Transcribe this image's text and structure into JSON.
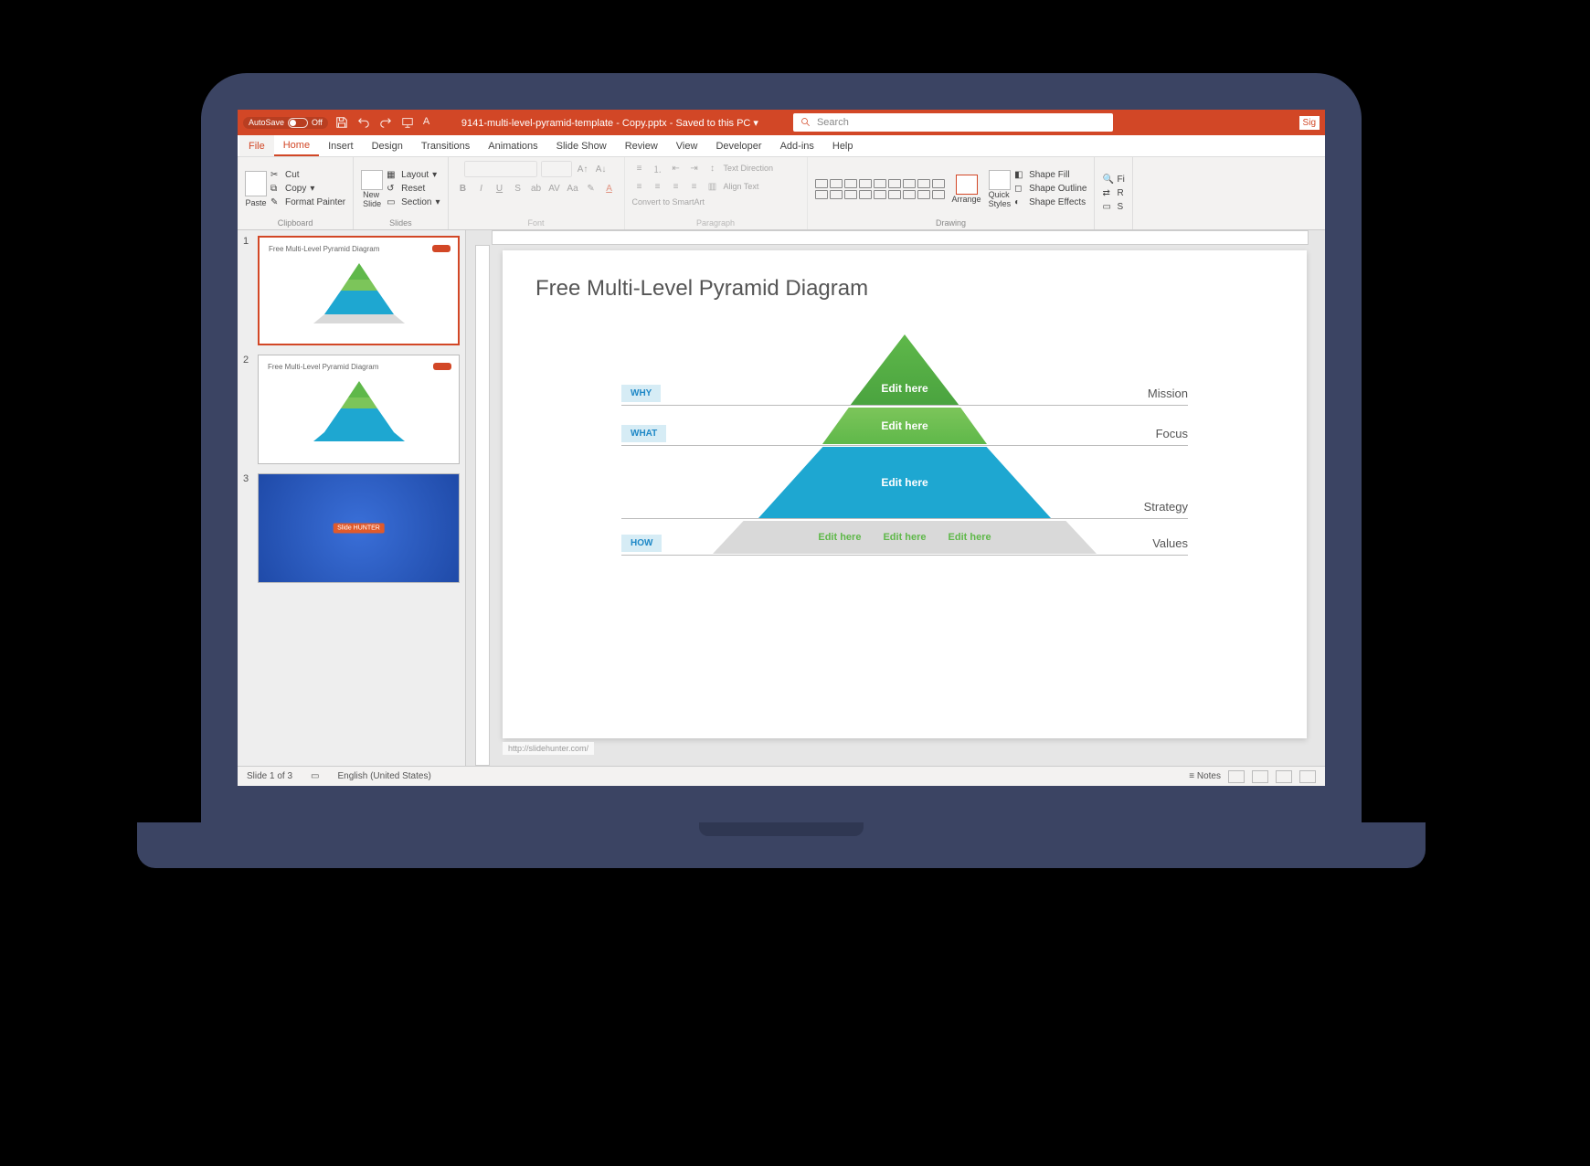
{
  "titlebar": {
    "autosave_label": "AutoSave",
    "autosave_state": "Off",
    "filename": "9141-multi-level-pyramid-template - Copy.pptx",
    "save_status": "Saved to this PC",
    "search_placeholder": "Search",
    "sign": "Sig"
  },
  "menu": {
    "file": "File",
    "home": "Home",
    "insert": "Insert",
    "design": "Design",
    "transitions": "Transitions",
    "animations": "Animations",
    "slideshow": "Slide Show",
    "review": "Review",
    "view": "View",
    "developer": "Developer",
    "addins": "Add-ins",
    "help": "Help"
  },
  "ribbon": {
    "paste": "Paste",
    "cut": "Cut",
    "copy": "Copy",
    "format_painter": "Format Painter",
    "clipboard": "Clipboard",
    "new_slide": "New\nSlide",
    "layout": "Layout",
    "reset": "Reset",
    "section": "Section",
    "slides": "Slides",
    "font": "Font",
    "paragraph": "Paragraph",
    "text_direction": "Text Direction",
    "align_text": "Align Text",
    "convert_smartart": "Convert to SmartArt",
    "arrange": "Arrange",
    "quick_styles": "Quick\nStyles",
    "shape_fill": "Shape Fill",
    "shape_outline": "Shape Outline",
    "shape_effects": "Shape Effects",
    "drawing": "Drawing",
    "find": "Fi",
    "replace": "R",
    "select": "S"
  },
  "thumbs": {
    "t1_title": "Free Multi-Level Pyramid Diagram",
    "t2_title": "Free Multi-Level Pyramid Diagram",
    "t3_logo": "Slide HUNTER"
  },
  "slide": {
    "title": "Free Multi-Level Pyramid Diagram",
    "left_why": "WHY",
    "left_what": "WHAT",
    "left_how": "HOW",
    "r_mission": "Mission",
    "r_focus": "Focus",
    "r_strategy": "Strategy",
    "r_values": "Values",
    "edit": "Edit here",
    "url": "http://slidehunter.com/"
  },
  "status": {
    "slide": "Slide 1 of 3",
    "lang": "English (United States)",
    "notes": "Notes"
  }
}
